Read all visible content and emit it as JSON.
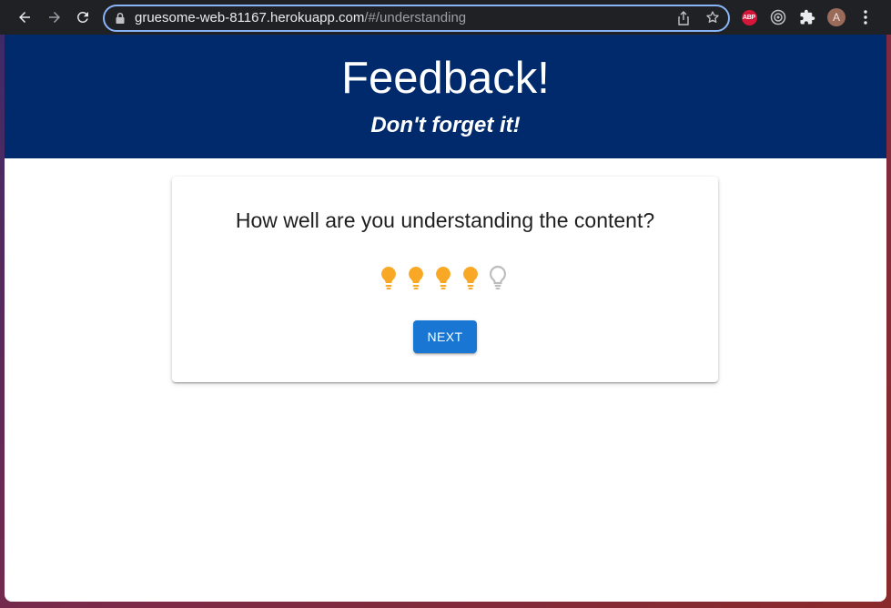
{
  "browser": {
    "url_host": "gruesome-web-81167.herokuapp.com",
    "url_path": "/#/understanding",
    "extensions": [
      "ABP"
    ],
    "profile_initial": "A"
  },
  "header": {
    "title": "Feedback!",
    "subtitle": "Don't forget it!"
  },
  "card": {
    "question": "How well are you understanding the content?",
    "rating": {
      "value": 4,
      "max": 5,
      "icon": "lightbulb-icon",
      "filled_color": "#f9a825",
      "empty_color": "#bdbdbd"
    },
    "next_label": "NEXT"
  },
  "colors": {
    "header_bg": "#002a6b",
    "button_bg": "#1976d2"
  }
}
